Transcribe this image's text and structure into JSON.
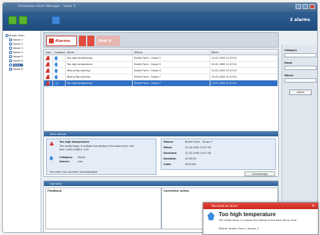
{
  "window": {
    "title": "Farmvision Alarm Manager - Victor 3"
  },
  "header": {
    "alarm_count": "3 alarms"
  },
  "tree": {
    "root": "Broiler Farm",
    "items": [
      "House 1",
      "House 2",
      "House 3",
      "House 4",
      "House 5",
      "House 6",
      "House 7",
      "House 8"
    ],
    "selected_index": 6
  },
  "tabs": {
    "alarms": "Alarms",
    "history": "Hist II"
  },
  "grid": {
    "columns": [
      "Type",
      "Category",
      "Alarm",
      "Where",
      "When"
    ],
    "rows": [
      {
        "alarm": "Too high temperature",
        "where": "Broiler Farm - House 2",
        "when": "22-02-2009 12:07:00",
        "selected": false
      },
      {
        "alarm": "Too high temperature",
        "where": "Broiler Farm - House 5",
        "when": "22-02-2009 12:07:00",
        "selected": false
      },
      {
        "alarm": "Wrong flap opening",
        "where": "Broiler Farm - House 4",
        "when": "22-02-2009 12:07:00",
        "selected": false
      },
      {
        "alarm": "Wrong flap opening",
        "where": "Broiler Farm - House 7",
        "when": "22-02-2009 12:07:00",
        "selected": false
      },
      {
        "alarm": "Too high temperature",
        "where": "Broiler Farm - House 7",
        "when": "22-02-2009 12:07:00",
        "selected": true
      }
    ]
  },
  "details": {
    "header": "Alarm details",
    "title": "Too high temperature",
    "desc": "The inside temp. is outside the setting of the back ense. Inst.",
    "desc2": "Inst: 1,000 (C8S0): 1.00",
    "category_label": "Category:",
    "category": "House",
    "source_label": "Source:",
    "source": "user",
    "where_label": "Where:",
    "where": "Broiler Farm - House 7",
    "when_label": "When:",
    "when": "22-02-2009 12:07:00",
    "received_label": "Received:",
    "received": "22-02-2009 12:07:00",
    "duration_label": "Duration:",
    "duration": "00:00:00",
    "code_label": "Code:",
    "code": "0011000",
    "ack_note": "The alarm has not been acknowledged",
    "ack_button": "Acknowledge"
  },
  "operation": {
    "header": "Operation",
    "feedback": "Feedback",
    "corrective": "Corrective action"
  },
  "filter": {
    "category": "Category",
    "room": "Room",
    "where": "Where",
    "button": "Select"
  },
  "popup": {
    "header": "Received an alarm",
    "title": "Too high temperature",
    "subtitle": "The inside temp. is outside the setting of the back temp. limit",
    "where": "Where: Broiler Farm / House 2"
  },
  "colors": {
    "accent": "#2f5e93",
    "alarm_red": "#d6302a",
    "selection": "#2f6fc6"
  }
}
